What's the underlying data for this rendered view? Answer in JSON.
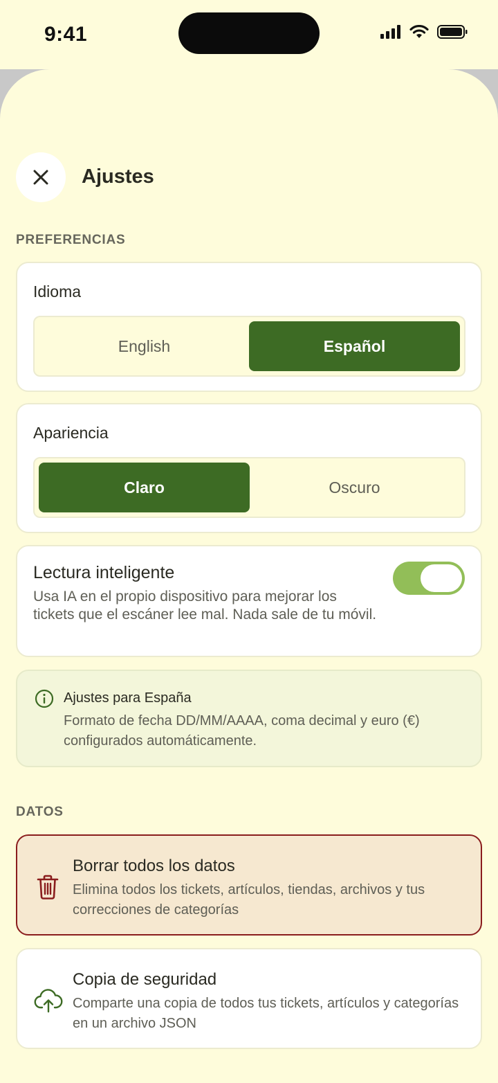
{
  "status_bar": {
    "time": "9:41",
    "icons": [
      "cellular-signal-icon",
      "wifi-icon",
      "battery-icon"
    ]
  },
  "header": {
    "title": "Ajustes",
    "close_icon": "close-icon"
  },
  "preferences": {
    "section_label": "PREFERENCIAS",
    "language": {
      "label": "Idioma",
      "options": [
        "English",
        "Español"
      ],
      "selected": "Español"
    },
    "appearance": {
      "label": "Apariencia",
      "options": [
        "Claro",
        "Oscuro"
      ],
      "selected": "Claro"
    },
    "smart_reading": {
      "title": "Lectura inteligente",
      "description": "Usa IA en el propio dispositivo para mejorar los tickets que el escáner lee mal. Nada sale de tu móvil.",
      "enabled": true
    },
    "region_info": {
      "icon": "info-icon",
      "title": "Ajustes para España",
      "description": "Formato de fecha DD/MM/AAAA, coma decimal y euro (€) configurados automáticamente."
    }
  },
  "data_section": {
    "section_label": "DATOS",
    "delete_all": {
      "icon": "trash-icon",
      "title": "Borrar todos los datos",
      "description": "Elimina todos los tickets, artículos, tiendas, archivos y tus correcciones de categorías"
    },
    "backup": {
      "icon": "cloud-upload-icon",
      "title": "Copia de seguridad",
      "description": "Comparte una copia de todos tus tickets, artículos y categorías en un archivo JSON"
    }
  },
  "colors": {
    "background": "#fefcdb",
    "accent": "#3d6b24",
    "toggle_on": "#92be58",
    "danger": "#8a1d1d",
    "danger_bg": "#f6e8d0"
  }
}
